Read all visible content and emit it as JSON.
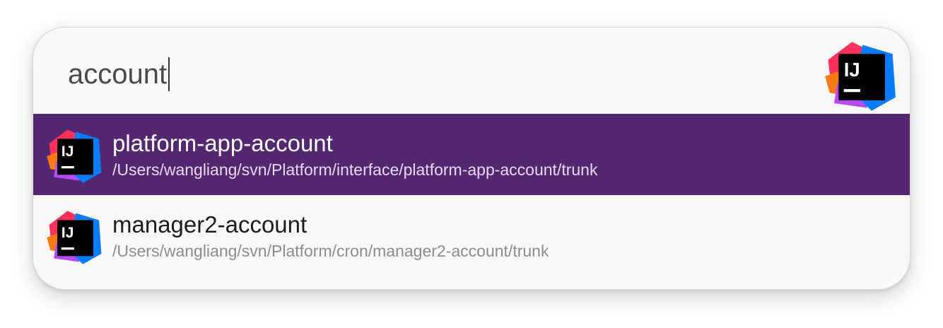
{
  "search": {
    "query": "account",
    "app_icon": "intellij-idea-icon"
  },
  "results": [
    {
      "title": "platform-app-account",
      "path": "/Users/wangliang/svn/Platform/interface/platform-app-account/trunk",
      "icon": "intellij-idea-icon",
      "selected": true
    },
    {
      "title": "manager2-account",
      "path": "/Users/wangliang/svn/Platform/cron/manager2-account/trunk",
      "icon": "intellij-idea-icon",
      "selected": false
    }
  ],
  "colors": {
    "selected_row": "#532870",
    "panel_bg": "#f9f8f7",
    "icon_tile": "#000000",
    "icon_red": "#fe315d",
    "icon_orange": "#f97a12",
    "icon_purple": "#b74af7",
    "icon_blue": "#087cfa"
  },
  "icon_glyph": "IJ"
}
